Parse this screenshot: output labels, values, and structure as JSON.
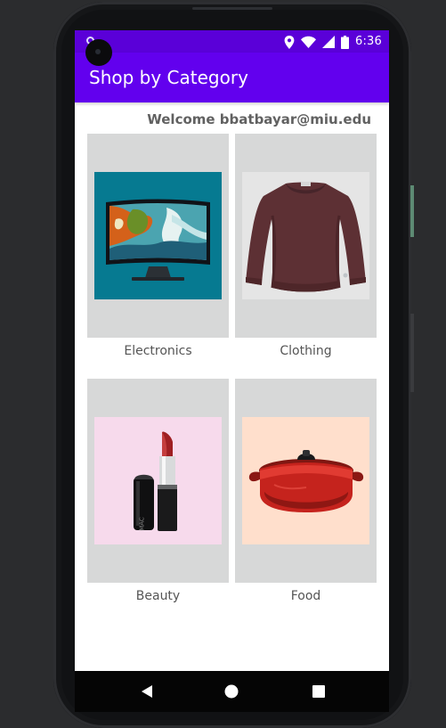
{
  "status_bar": {
    "time": "6:36",
    "icons": [
      "notification-dot-icon",
      "location-icon",
      "wifi-icon",
      "signal-icon",
      "battery-icon"
    ]
  },
  "app_bar": {
    "title": "Shop by Category"
  },
  "welcome_text": "Welcome bbatbayar@miu.edu",
  "categories": [
    {
      "label": "Electronics",
      "image": "television"
    },
    {
      "label": "Clothing",
      "image": "sweatshirt"
    },
    {
      "label": "Beauty",
      "image": "lipstick"
    },
    {
      "label": "Food",
      "image": "cooking-pot"
    }
  ],
  "navigation": {
    "buttons": [
      "back-icon",
      "home-icon",
      "recent-apps-icon"
    ]
  },
  "colors": {
    "status_bar": "#5a00d8",
    "app_bar": "#6200ee",
    "card_background": "#d7d8d8",
    "tv_background": "#067a91",
    "beauty_background": "#f7daec",
    "food_background": "#ffdfcc"
  }
}
